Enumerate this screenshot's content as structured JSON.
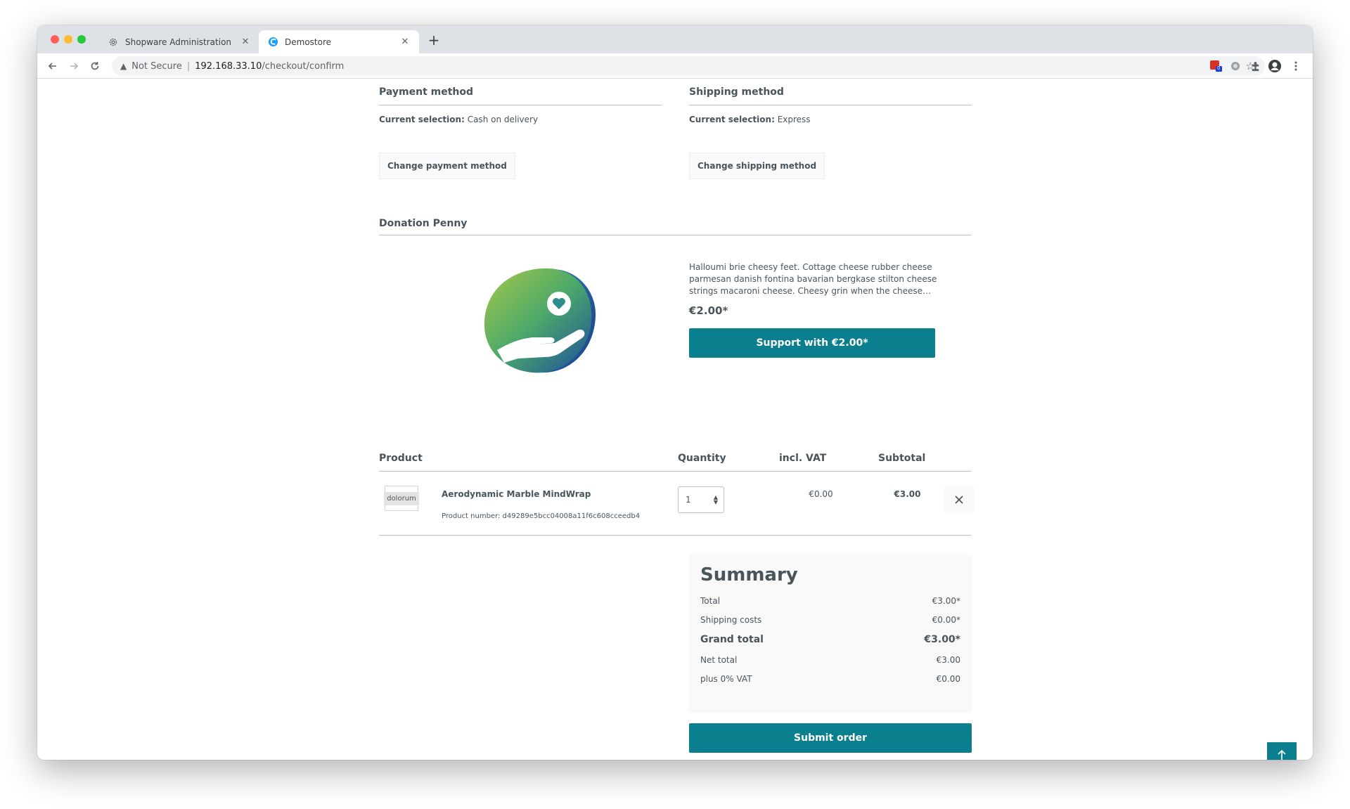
{
  "browser": {
    "tabs": [
      {
        "title": "Shopware Administration",
        "active": false
      },
      {
        "title": "Demostore",
        "active": true
      }
    ],
    "address": {
      "security_label": "Not Secure",
      "host": "192.168.33.10",
      "path": "/checkout/confirm"
    },
    "extension_badge": "0"
  },
  "payment": {
    "title": "Payment method",
    "selection_label": "Current selection:",
    "selection_value": "Cash on delivery",
    "change_label": "Change payment method"
  },
  "shipping": {
    "title": "Shipping method",
    "selection_label": "Current selection:",
    "selection_value": "Express",
    "change_label": "Change shipping method"
  },
  "donation": {
    "title": "Donation Penny",
    "description": "Halloumi brie cheesy feet. Cottage cheese rubber cheese parmesan danish fontina bavarian bergkase stilton cheese strings macaroni cheese. Cheesy grin when the cheese…",
    "price": "€2.00*",
    "button_label": "Support with €2.00*"
  },
  "cart": {
    "headers": {
      "product": "Product",
      "quantity": "Quantity",
      "vat": "incl. VAT",
      "subtotal": "Subtotal"
    },
    "items": [
      {
        "thumb_text": "dolorum",
        "name": "Aerodynamic Marble MindWrap",
        "product_number": "Product number: d49289e5bcc04008a11f6c608cceedb4",
        "quantity": "1",
        "vat": "€0.00",
        "subtotal": "€3.00"
      }
    ]
  },
  "summary": {
    "title": "Summary",
    "rows": [
      {
        "label": "Total",
        "value": "€3.00*"
      },
      {
        "label": "Shipping costs",
        "value": "€0.00*"
      },
      {
        "label": "Grand total",
        "value": "€3.00*"
      },
      {
        "label": "Net total",
        "value": "€3.00"
      },
      {
        "label": "plus 0% VAT",
        "value": "€0.00"
      }
    ]
  },
  "submit_label": "Submit order",
  "colors": {
    "primary": "#0b7f8d",
    "text": "#4a545b",
    "donation_green": "#8fc04a",
    "donation_blue": "#1f4f9a"
  }
}
